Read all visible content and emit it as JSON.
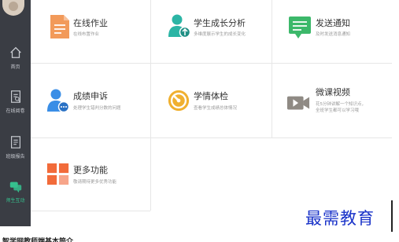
{
  "sidebar": {
    "items": [
      {
        "label": "首页",
        "icon": "home-icon"
      },
      {
        "label": "在线阅卷",
        "icon": "exam-review-icon"
      },
      {
        "label": "班级报告",
        "icon": "report-icon"
      },
      {
        "label": "师生互动",
        "icon": "chat-icon",
        "active": true
      }
    ],
    "active_color": "#35c08e"
  },
  "tiles": [
    {
      "title": "在线作业",
      "subtitle": "在线布置作业",
      "icon": "homework-doc-icon",
      "color": "#f29a5a"
    },
    {
      "title": "学生成长分析",
      "subtitle": "多维度展示学生的成长变化",
      "icon": "growth-person-icon",
      "color": "#2bb5a5"
    },
    {
      "title": "发送通知",
      "subtitle": "及时发送消息通知",
      "icon": "notice-message-icon",
      "color": "#3cb86a"
    },
    {
      "title": "成绩申诉",
      "subtitle": "处理学生错判分数的问题",
      "icon": "appeal-person-icon",
      "color": "#3a8ee6"
    },
    {
      "title": "学情体检",
      "subtitle": "查看学生成绩总体情况",
      "icon": "checkup-gauge-icon",
      "color": "#f0b030"
    },
    {
      "title": "微课视频",
      "subtitle_lines": [
        "花5分钟讲解一个知识点，",
        "全班学生都可以学习哦"
      ],
      "icon": "video-camera-icon",
      "color": "#8f8a84"
    },
    {
      "title": "更多功能",
      "subtitle": "敬请期待更多优秀功能",
      "icon": "more-grid-icon",
      "color": "#f26b3a"
    }
  ],
  "footer": {
    "heading": "智学网教师端基本简介"
  },
  "watermark": "最需教育"
}
